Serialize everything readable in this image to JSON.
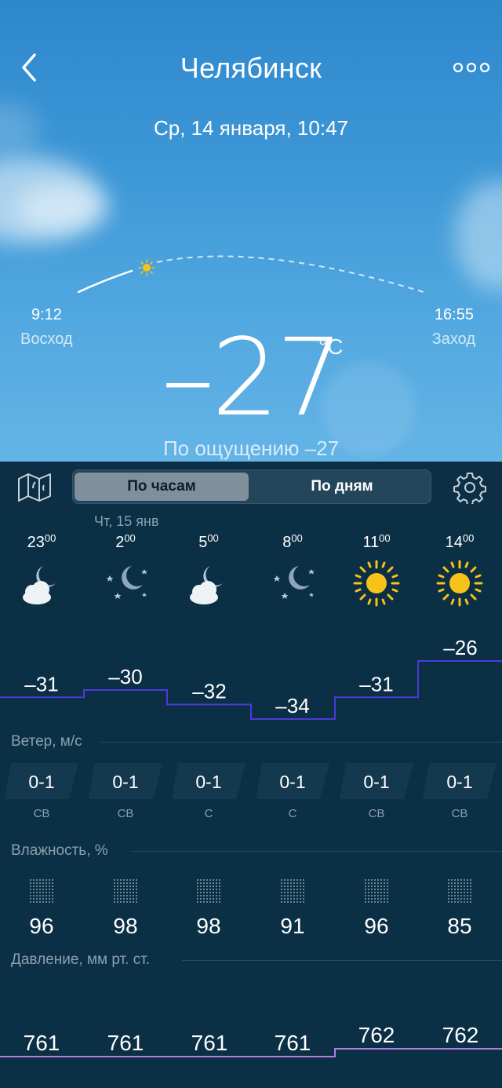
{
  "header": {
    "city": "Челябинск",
    "datetime": "Ср, 14 января, 10:47"
  },
  "sun": {
    "sunrise_time": "9:12",
    "sunrise_label": "Восход",
    "sunset_time": "16:55",
    "sunset_label": "Заход"
  },
  "current": {
    "temperature": "–27",
    "unit": "°C",
    "feels_like": "По ощущению –27"
  },
  "toolbar": {
    "tab_hourly": "По часам",
    "tab_daily": "По дням",
    "active_tab": "hourly"
  },
  "hourly": {
    "day_label": "Чт, 15 янв",
    "items": [
      {
        "hour": "23",
        "min": "00",
        "icon": "cloud-moon-icon",
        "temp": "–31",
        "wind": "0-1",
        "wind_dir": "СВ",
        "humidity": "96",
        "pressure": "761"
      },
      {
        "hour": "2",
        "min": "00",
        "icon": "moon-stars-icon",
        "temp": "–30",
        "wind": "0-1",
        "wind_dir": "СВ",
        "humidity": "98",
        "pressure": "761"
      },
      {
        "hour": "5",
        "min": "00",
        "icon": "cloud-moon-icon",
        "temp": "–32",
        "wind": "0-1",
        "wind_dir": "С",
        "humidity": "98",
        "pressure": "761"
      },
      {
        "hour": "8",
        "min": "00",
        "icon": "moon-stars-icon",
        "temp": "–34",
        "wind": "0-1",
        "wind_dir": "С",
        "humidity": "91",
        "pressure": "761"
      },
      {
        "hour": "11",
        "min": "00",
        "icon": "sun-icon",
        "temp": "–31",
        "wind": "0-1",
        "wind_dir": "СВ",
        "humidity": "96",
        "pressure": "762"
      },
      {
        "hour": "14",
        "min": "00",
        "icon": "sun-icon",
        "temp": "–26",
        "wind": "0-1",
        "wind_dir": "СВ",
        "humidity": "85",
        "pressure": "762"
      }
    ]
  },
  "sections": {
    "wind_title": "Ветер, м/с",
    "humidity_title": "Влажность, %",
    "pressure_title": "Давление, мм рт. ст."
  },
  "colors": {
    "temp_line": "#4b3bd8",
    "pressure_line": "#b07ee0",
    "sun": "#f7c21a",
    "panel": "#0b2f44"
  }
}
